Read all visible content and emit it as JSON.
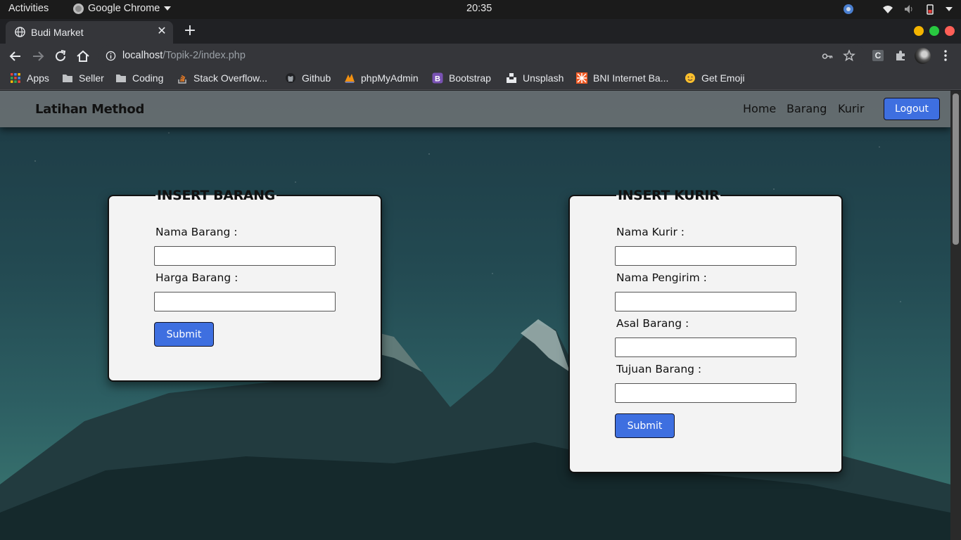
{
  "os_topbar": {
    "activities": "Activities",
    "app_name": "Google Chrome",
    "clock": "20:35"
  },
  "browser": {
    "tab_title": "Budi Market",
    "url_host": "localhost",
    "url_path": "/Topik-2/index.php",
    "extension_letter": "C",
    "window_colors": {
      "minimize": "#f4b400",
      "maximize": "#28c840",
      "close": "#ff5f57"
    },
    "bookmarks": [
      {
        "label": "Apps",
        "icon": "apps-grid-icon"
      },
      {
        "label": "Seller",
        "icon": "folder-icon"
      },
      {
        "label": "Coding",
        "icon": "folder-icon"
      },
      {
        "label": "Stack Overflow...",
        "icon": "stackoverflow-icon"
      },
      {
        "label": "Github",
        "icon": "github-icon"
      },
      {
        "label": "phpMyAdmin",
        "icon": "phpmyadmin-icon"
      },
      {
        "label": "Bootstrap",
        "icon": "bootstrap-icon"
      },
      {
        "label": "Unsplash",
        "icon": "unsplash-icon"
      },
      {
        "label": "BNI Internet Ba...",
        "icon": "bni-icon"
      },
      {
        "label": "Get Emoji",
        "icon": "emoji-icon"
      }
    ]
  },
  "page": {
    "brand": "Latihan Method",
    "nav": [
      "Home",
      "Barang",
      "Kurir"
    ],
    "logout": "Logout",
    "accent_color": "#3e6fe0",
    "forms": {
      "barang": {
        "title": "INSERT BARANG",
        "fields": [
          "Nama Barang :",
          "Harga Barang :"
        ],
        "values": [
          "",
          ""
        ],
        "submit": "Submit"
      },
      "kurir": {
        "title": "INSERT KURIR",
        "fields": [
          "Nama Kurir :",
          "Nama Pengirim :",
          "Asal Barang :",
          "Tujuan Barang :"
        ],
        "values": [
          "",
          "",
          "",
          ""
        ],
        "submit": "Submit"
      }
    }
  }
}
